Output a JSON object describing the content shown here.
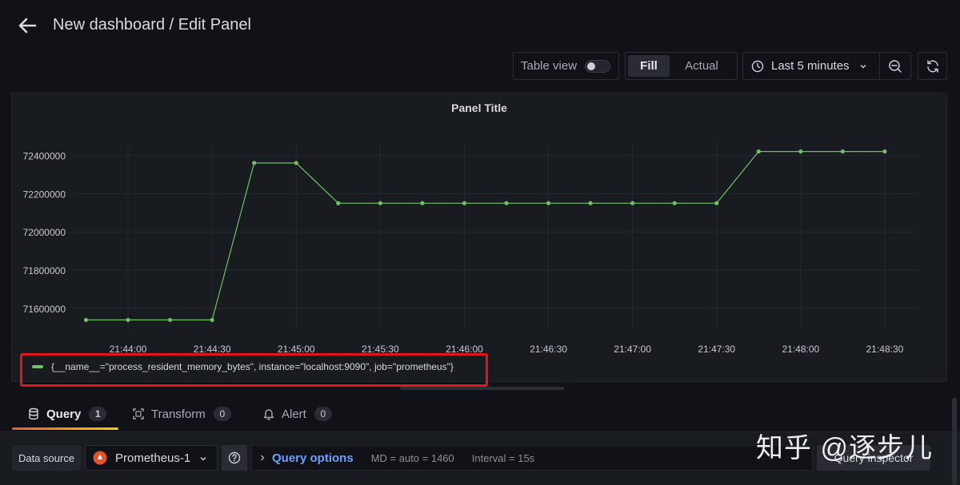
{
  "header": {
    "title": "New dashboard / Edit Panel"
  },
  "toolbar": {
    "table_view_label": "Table view",
    "table_view_on": false,
    "fill_label": "Fill",
    "actual_label": "Actual",
    "time_range_label": "Last 5 minutes"
  },
  "panel": {
    "title": "Panel Title",
    "legend_label": "{__name__=\"process_resident_memory_bytes\", instance=\"localhost:9090\", job=\"prometheus\"}"
  },
  "chart_data": {
    "type": "line",
    "title": "Panel Title",
    "xlabel": "",
    "ylabel": "",
    "x": [
      "21:43:45",
      "21:44:00",
      "21:44:15",
      "21:44:30",
      "21:44:45",
      "21:45:00",
      "21:45:15",
      "21:45:30",
      "21:45:45",
      "21:46:00",
      "21:46:15",
      "21:46:30",
      "21:46:45",
      "21:47:00",
      "21:47:15",
      "21:47:30",
      "21:47:45",
      "21:48:00",
      "21:48:15",
      "21:48:30"
    ],
    "series": [
      {
        "name": "{__name__=\"process_resident_memory_bytes\", instance=\"localhost:9090\", job=\"prometheus\"}",
        "color": "#73bf69",
        "values": [
          71540000,
          71540000,
          71540000,
          71540000,
          72360000,
          72360000,
          72150000,
          72150000,
          72150000,
          72150000,
          72150000,
          72150000,
          72150000,
          72150000,
          72150000,
          72150000,
          72420000,
          72420000,
          72420000,
          72420000
        ]
      }
    ],
    "x_ticks": [
      "21:44:00",
      "21:44:30",
      "21:45:00",
      "21:45:30",
      "21:46:00",
      "21:46:30",
      "21:47:00",
      "21:47:30",
      "21:48:00",
      "21:48:30"
    ],
    "y_ticks": [
      71600000,
      71800000,
      72000000,
      72200000,
      72400000
    ],
    "y_tick_labels": [
      "71600000",
      "71800000",
      "72000000",
      "72200000",
      "72400000"
    ],
    "xlim": [
      "21:43:40",
      "21:48:42"
    ],
    "ylim": [
      71500000,
      72460000
    ],
    "grid": true,
    "legend": "bottom-left"
  },
  "tabs": [
    {
      "label": "Query",
      "count": "1",
      "icon": "database-icon",
      "active": true
    },
    {
      "label": "Transform",
      "count": "0",
      "icon": "transform-icon",
      "active": false
    },
    {
      "label": "Alert",
      "count": "0",
      "icon": "bell-icon",
      "active": false
    }
  ],
  "query": {
    "data_source_label": "Data source",
    "data_source_value": "Prometheus-1",
    "query_options_label": "Query options",
    "md_text": "MD = auto = 1460",
    "interval_text": "Interval = 15s",
    "inspector_label": "Query inspector"
  },
  "watermark": {
    "text": "知乎 @逐步儿"
  },
  "colors": {
    "series": "#73bf69",
    "accent_link": "#6e9fff",
    "highlight_border": "#e0171a"
  }
}
